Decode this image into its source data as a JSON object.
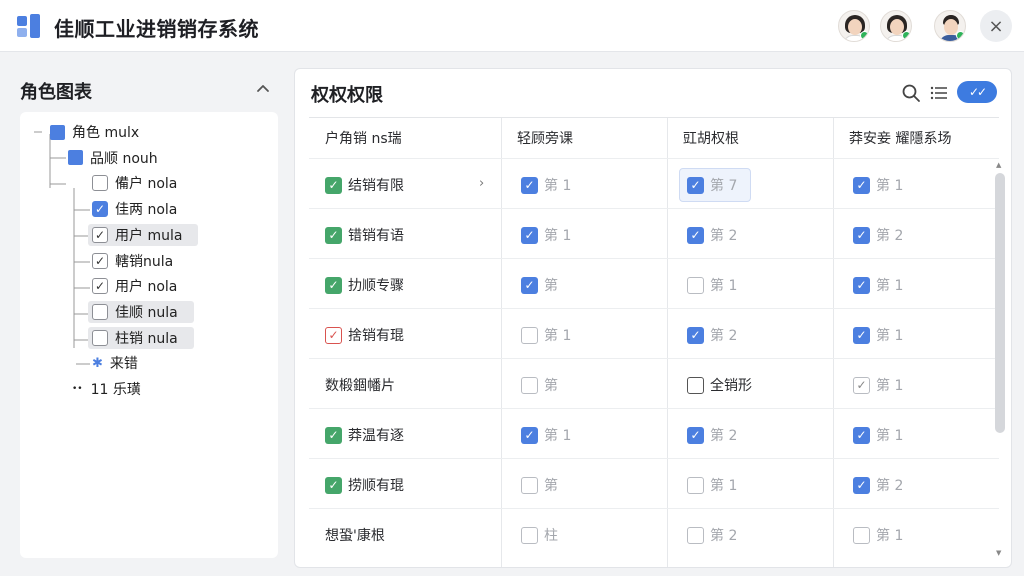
{
  "header": {
    "title": "佳顺工业进销销存系统",
    "close_icon": "×"
  },
  "left": {
    "title": "角色图表",
    "tree": [
      {
        "label": "角色 mulx",
        "kind": "folder"
      },
      {
        "label": "品顺 nouh",
        "kind": "folder"
      },
      {
        "label": "備户 nola",
        "kind": "checkbox",
        "checked": false
      },
      {
        "label": "佳两 nola",
        "kind": "checkbox",
        "checked": true,
        "style": "blue"
      },
      {
        "label": "用户 mula",
        "kind": "checkbox",
        "checked": true,
        "selected": true
      },
      {
        "label": "轄销nula",
        "kind": "checkbox",
        "checked": true
      },
      {
        "label": "用户 nola",
        "kind": "checkbox",
        "checked": true
      },
      {
        "label": "佳顺 nula",
        "kind": "checkbox",
        "checked": false,
        "selected": true
      },
      {
        "label": "柱销 nula",
        "kind": "checkbox",
        "checked": false,
        "selected": true
      },
      {
        "label": "来错",
        "kind": "puzzle"
      },
      {
        "label": "11  乐璜",
        "kind": "dots"
      }
    ]
  },
  "right": {
    "title": "权权权限",
    "toggle": "✓✓",
    "columns": [
      "户角销 ns瑞",
      "轻顾旁课",
      "豇胡权根",
      "莽安妾 耀隱系场"
    ],
    "rows": [
      {
        "name": "结销有限",
        "name_state": "green",
        "chevron": "›",
        "cells": [
          {
            "state": "blue",
            "text": "第 1"
          },
          {
            "state": "blue",
            "text": "第 7",
            "highlight": true
          },
          {
            "state": "blue",
            "text": "第 1"
          }
        ]
      },
      {
        "name": "错销有语",
        "name_state": "green",
        "cells": [
          {
            "state": "blue",
            "text": "第 1"
          },
          {
            "state": "blue",
            "text": "第 2"
          },
          {
            "state": "blue",
            "text": "第 2"
          }
        ]
      },
      {
        "name": "扐顺专骤",
        "name_state": "green",
        "cells": [
          {
            "state": "blue",
            "text": "第"
          },
          {
            "state": "empty",
            "text": "第 1"
          },
          {
            "state": "blue",
            "text": "第 1"
          }
        ]
      },
      {
        "name": "捨销有琨",
        "name_state": "red",
        "cells": [
          {
            "state": "empty",
            "text": "第 1"
          },
          {
            "state": "blue",
            "text": "第 2"
          },
          {
            "state": "blue",
            "text": "第 1"
          }
        ]
      },
      {
        "name": "数椴錮幡片",
        "name_state": "none",
        "cells": [
          {
            "state": "empty",
            "text": "第"
          },
          {
            "state": "dark",
            "text": "全销形",
            "strong": true
          },
          {
            "state": "emptyc",
            "text": "第 1"
          }
        ]
      },
      {
        "name": "莽温有逐",
        "name_state": "green",
        "cells": [
          {
            "state": "blue",
            "text": "第 1"
          },
          {
            "state": "blue",
            "text": "第 2"
          },
          {
            "state": "blue",
            "text": "第 1"
          }
        ]
      },
      {
        "name": "捞顺有琨",
        "name_state": "green",
        "cells": [
          {
            "state": "empty",
            "text": "第"
          },
          {
            "state": "empty",
            "text": "第 1"
          },
          {
            "state": "blue",
            "text": "第 2"
          }
        ]
      },
      {
        "name": "想蛩'康根",
        "name_state": "none",
        "cells": [
          {
            "state": "empty",
            "text": "柱"
          },
          {
            "state": "empty",
            "text": "第 2"
          },
          {
            "state": "empty",
            "text": "第 1"
          }
        ]
      }
    ]
  },
  "colors": {
    "accent": "#4c7fe0",
    "green": "#45a66a",
    "red": "#d9534f"
  }
}
